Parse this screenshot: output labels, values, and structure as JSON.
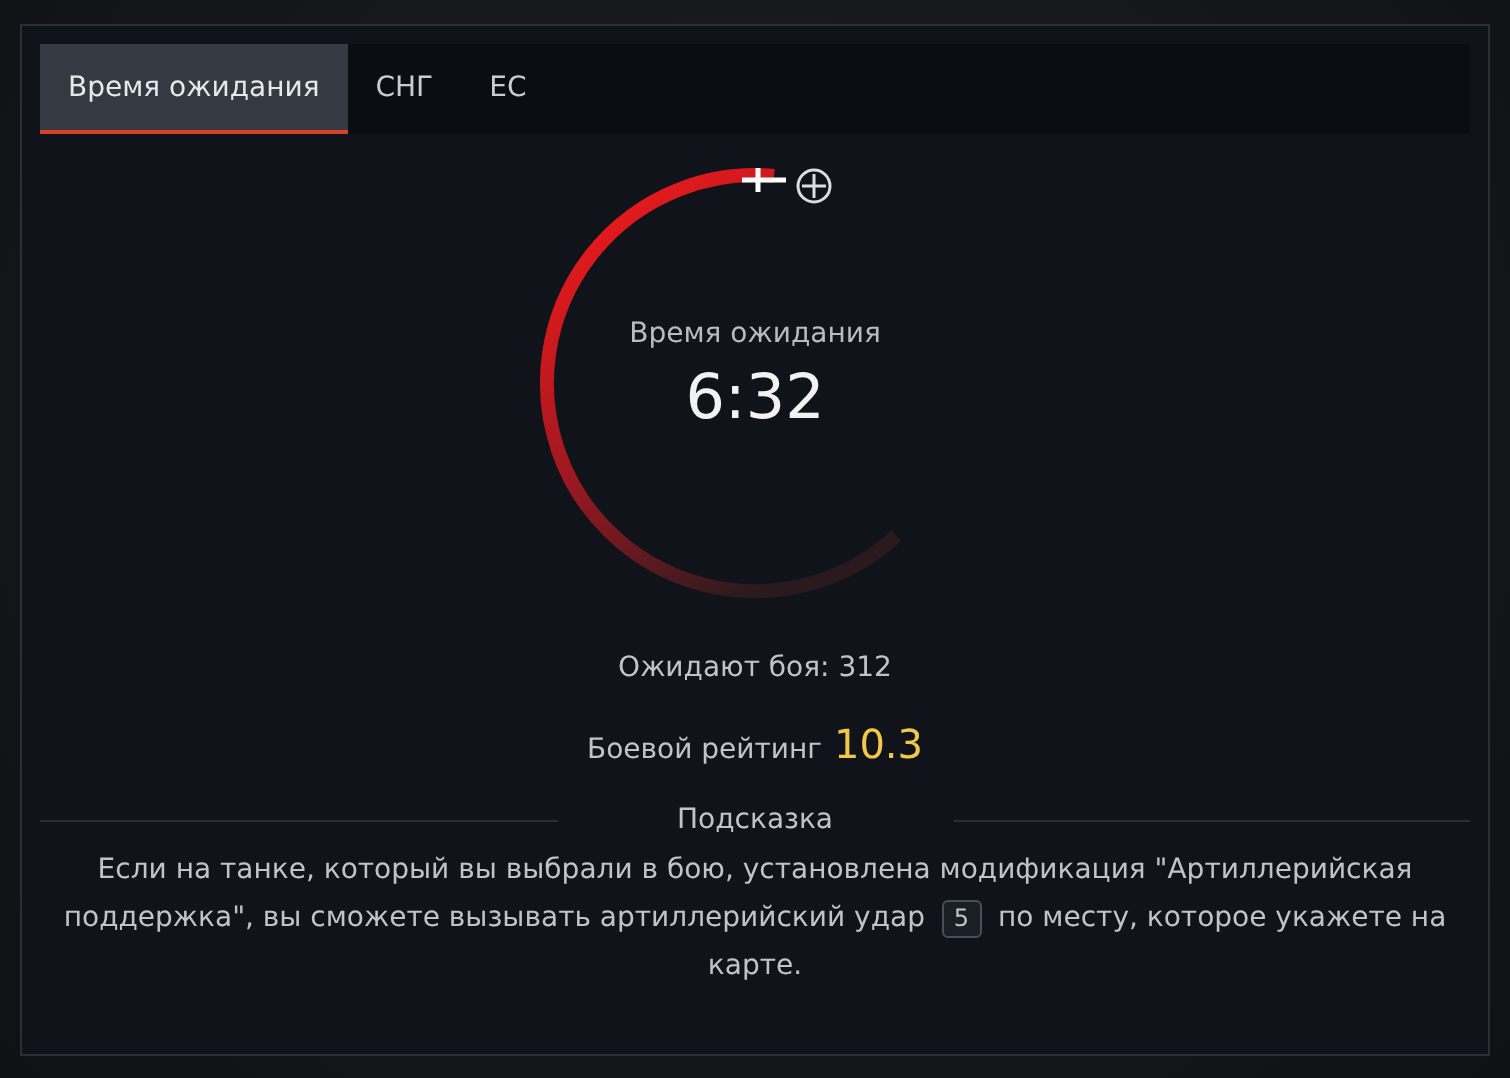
{
  "tabs": [
    {
      "label": "Время ожидания",
      "selected": true
    },
    {
      "label": "СНГ",
      "selected": false
    },
    {
      "label": "ЕС",
      "selected": false
    }
  ],
  "timer": {
    "label": "Время ожидания",
    "value": "6:32"
  },
  "waiting": "Ожидают боя: 312",
  "rating": {
    "label": "Боевой рейтинг",
    "value": "10.3"
  },
  "hint": {
    "title": "Подсказка",
    "text_before": "Если на танке, который вы выбрали в бою, установлена модификация \"Артиллерийская поддержка\", вы сможете вызывать артиллерийский удар",
    "key": "5",
    "text_after": "по месту, которое укажете на карте."
  }
}
